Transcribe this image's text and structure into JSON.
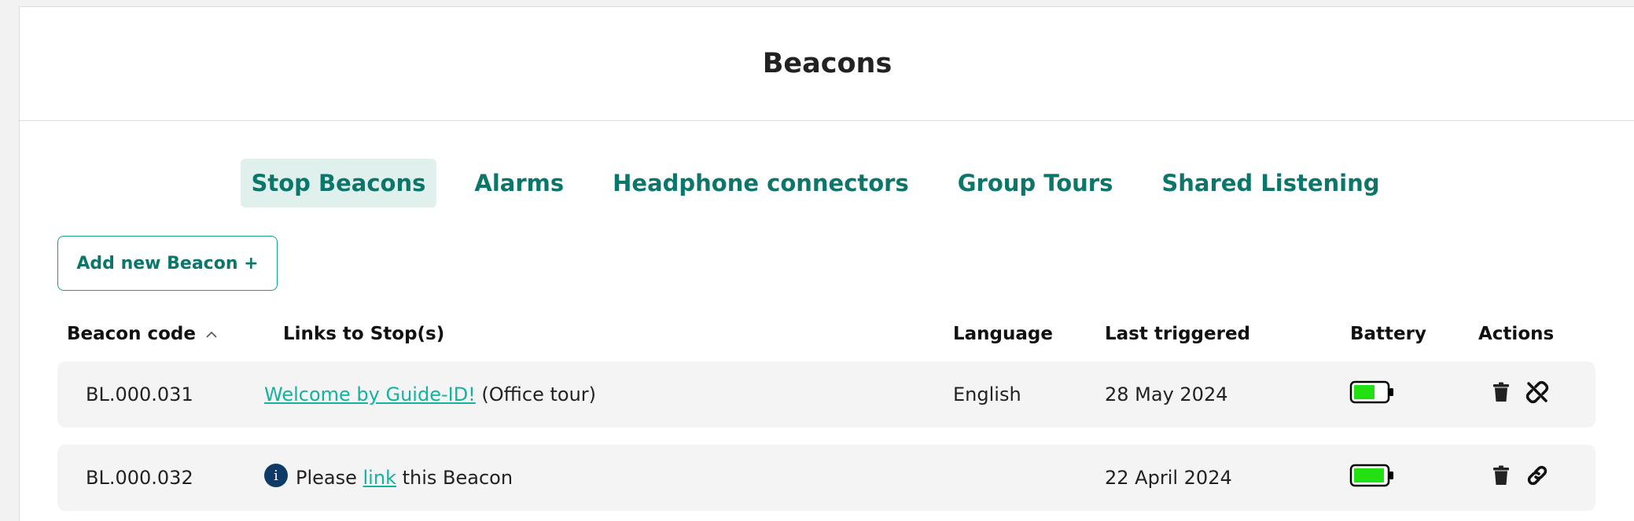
{
  "header": {
    "title": "Beacons"
  },
  "tabs": [
    {
      "label": "Stop Beacons",
      "active": true
    },
    {
      "label": "Alarms",
      "active": false
    },
    {
      "label": "Headphone connectors",
      "active": false
    },
    {
      "label": "Group Tours",
      "active": false
    },
    {
      "label": "Shared Listening",
      "active": false
    }
  ],
  "toolbar": {
    "add_label": "Add new Beacon +"
  },
  "table": {
    "columns": {
      "code": "Beacon code",
      "links": "Links to Stop(s)",
      "language": "Language",
      "last": "Last triggered",
      "battery": "Battery",
      "actions": "Actions"
    },
    "sort": {
      "column": "Beacon code",
      "direction": "ascending"
    },
    "rows": [
      {
        "code": "BL.000.031",
        "link_text": "Welcome by Guide-ID!",
        "link_suffix": " (Office tour)",
        "language": "English",
        "last": "28 May 2024",
        "battery_level": 0.65,
        "action_icons": [
          "trash-icon",
          "unlink-icon"
        ]
      },
      {
        "code": "BL.000.032",
        "prompt_before": "Please ",
        "prompt_link": "link",
        "prompt_after": " this Beacon",
        "language": "",
        "last": "22 April 2024",
        "battery_level": 0.95,
        "action_icons": [
          "trash-icon",
          "link-icon"
        ]
      }
    ]
  },
  "colors": {
    "accent": "#0b7669",
    "link": "#14b3a0",
    "tab_active_bg": "#e0f1ed",
    "battery_fill": "#22e012",
    "info_icon": "#0d3a66",
    "row_bg": "#f4f4f4"
  }
}
